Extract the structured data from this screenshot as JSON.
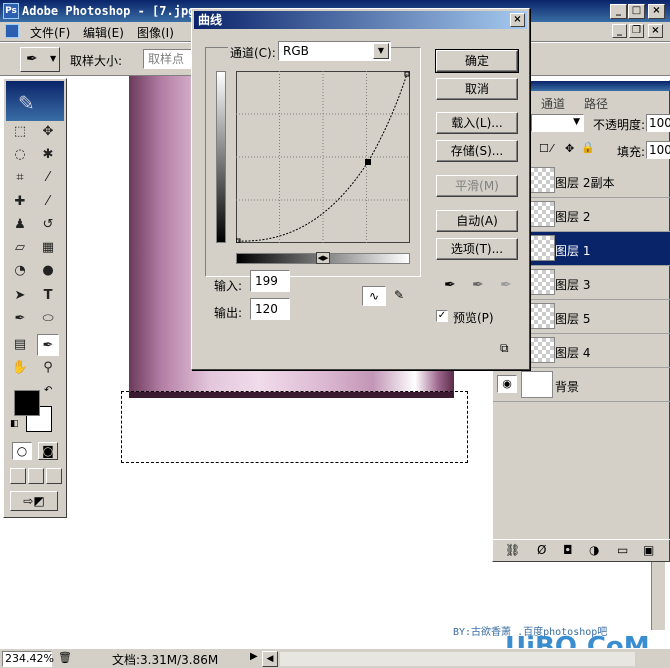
{
  "window": {
    "title": "Adobe Photoshop - [7.jpg"
  },
  "menu": {
    "file": "文件(F)",
    "edit": "编辑(E)",
    "image": "图像(I)"
  },
  "options": {
    "sample_size_label": "取样大小:",
    "sample_size_value": "取样点"
  },
  "curves_dialog": {
    "title": "曲线",
    "channel_label": "通道(C):",
    "channel_value": "RGB",
    "ok": "确定",
    "cancel": "取消",
    "load": "载入(L)...",
    "save": "存储(S)...",
    "smooth": "平滑(M)",
    "auto": "自动(A)",
    "options": "选项(T)...",
    "input_label": "输入:",
    "input_value": "199",
    "output_label": "输出:",
    "output_value": "120",
    "preview_label": "预览(P)",
    "preview_checked": true
  },
  "layers_panel": {
    "tab_channels": "通道",
    "tab_paths": "路径",
    "opacity_label": "不透明度:",
    "opacity_value": "100",
    "fill_label": "填充:",
    "fill_value": "100",
    "layers": [
      {
        "name": "图层 2副本",
        "selected": false
      },
      {
        "name": "图层 2",
        "selected": false
      },
      {
        "name": "图层 1",
        "selected": true
      },
      {
        "name": "图层 3",
        "selected": false
      },
      {
        "name": "图层 5",
        "selected": false
      },
      {
        "name": "图层 4",
        "selected": false
      },
      {
        "name": "背景",
        "selected": false
      }
    ]
  },
  "status": {
    "zoom": "234.42%",
    "doc_info": "文档:3.31M/3.86M"
  },
  "watermark": {
    "byline": "BY:古欲香萧 .百度photoshop吧",
    "logo": "UiBQ.CoM"
  },
  "colors": {
    "accent": "#0a246a",
    "chrome": "#d4d0c8"
  }
}
